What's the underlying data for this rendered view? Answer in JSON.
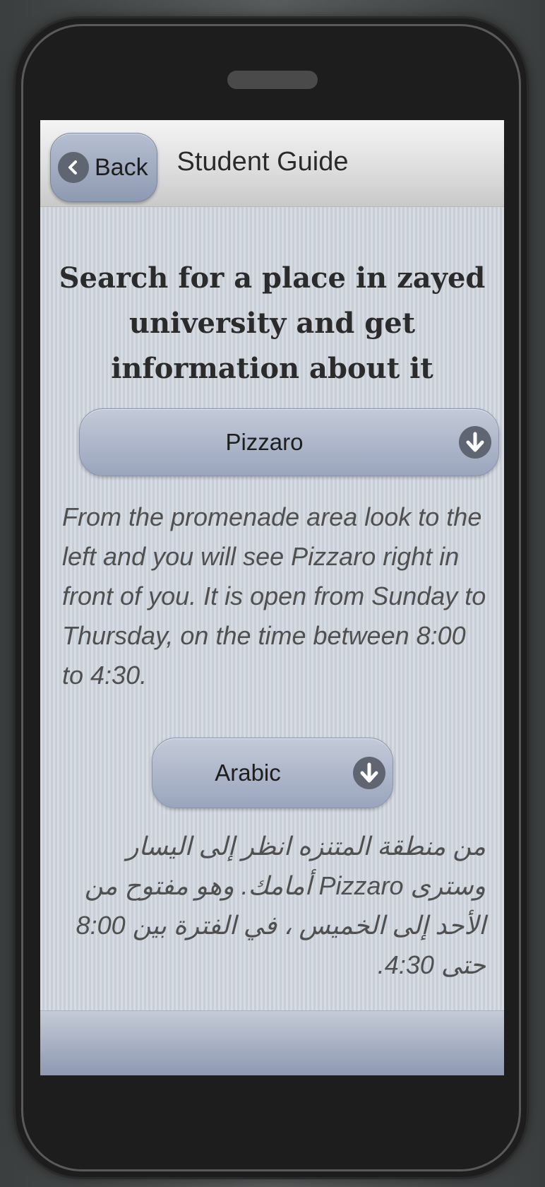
{
  "header": {
    "back_label": "Back",
    "title": "Student Guide"
  },
  "main": {
    "heading": "Search for a place in zayed university and get information about it",
    "place_select": {
      "selected": "Pizzaro"
    },
    "description_en": "From the promenade area look to the left and you will see Pizzaro right in front of you. It is open from Sunday to Thursday, on the time between 8:00 to 4:30.",
    "language_select": {
      "selected": "Arabic"
    },
    "description_ar": "من منطقة المتنزه انظر إلى اليسار وسترى Pizzaro أمامك. وهو مفتوح من الأحد إلى الخميس ، في الفترة بين 8:00 حتى 4:30."
  },
  "icons": {
    "back": "chevron-left-icon",
    "select_arrow": "arrow-down-icon"
  },
  "colors": {
    "header_bg": "#dcdcdc",
    "button_bg": "#9aa5bd",
    "icon_circle": "#5f6672",
    "content_bg": "#cfd4dc",
    "footer_bg": "#8d99b2"
  }
}
